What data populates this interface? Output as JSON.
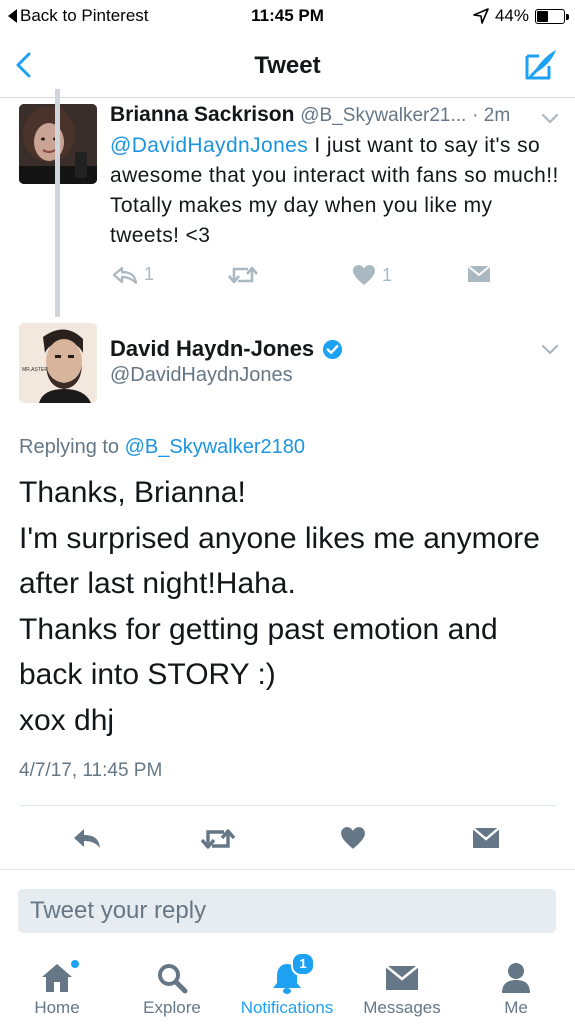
{
  "status_bar": {
    "back_label": "Back to Pinterest",
    "time": "11:45 PM",
    "battery": "44%",
    "battery_level": 0.44
  },
  "nav": {
    "title": "Tweet",
    "back_icon": "chevron-left-icon",
    "compose_icon": "compose-icon"
  },
  "parent_tweet": {
    "name": "Brianna Sackrison",
    "handle": "@B_Skywalker21...",
    "age": "· 2m",
    "mention": "@DavidHaydnJones",
    "text": " I just want to say it's so awesome that you interact with fans so much!! Totally makes my day when you like my tweets! <3",
    "reply_count": "1",
    "like_count": "1"
  },
  "main_tweet": {
    "name": "David Haydn-Jones",
    "handle": "@DavidHaydnJones",
    "replying_prefix": "Replying to ",
    "replying_handle": "@B_Skywalker2180",
    "lines": [
      "Thanks, Brianna!",
      "I'm surprised anyone likes me anymore",
      "after last night!Haha.",
      "Thanks for getting past emotion and",
      "back into STORY :)",
      "xox dhj"
    ],
    "timestamp": "4/7/17, 11:45 PM"
  },
  "reply_box": {
    "placeholder": "Tweet your reply"
  },
  "tabs": [
    {
      "label": "Home",
      "icon": "home-icon"
    },
    {
      "label": "Explore",
      "icon": "search-icon"
    },
    {
      "label": "Notifications",
      "icon": "bell-icon",
      "badge": "1"
    },
    {
      "label": "Messages",
      "icon": "envelope-icon"
    },
    {
      "label": "Me",
      "icon": "person-icon"
    }
  ],
  "colors": {
    "accent": "#1da1f2",
    "link": "#1b95e0",
    "muted": "#657786",
    "icon_gray": "#aab8c2",
    "dark_icon": "#657786"
  }
}
